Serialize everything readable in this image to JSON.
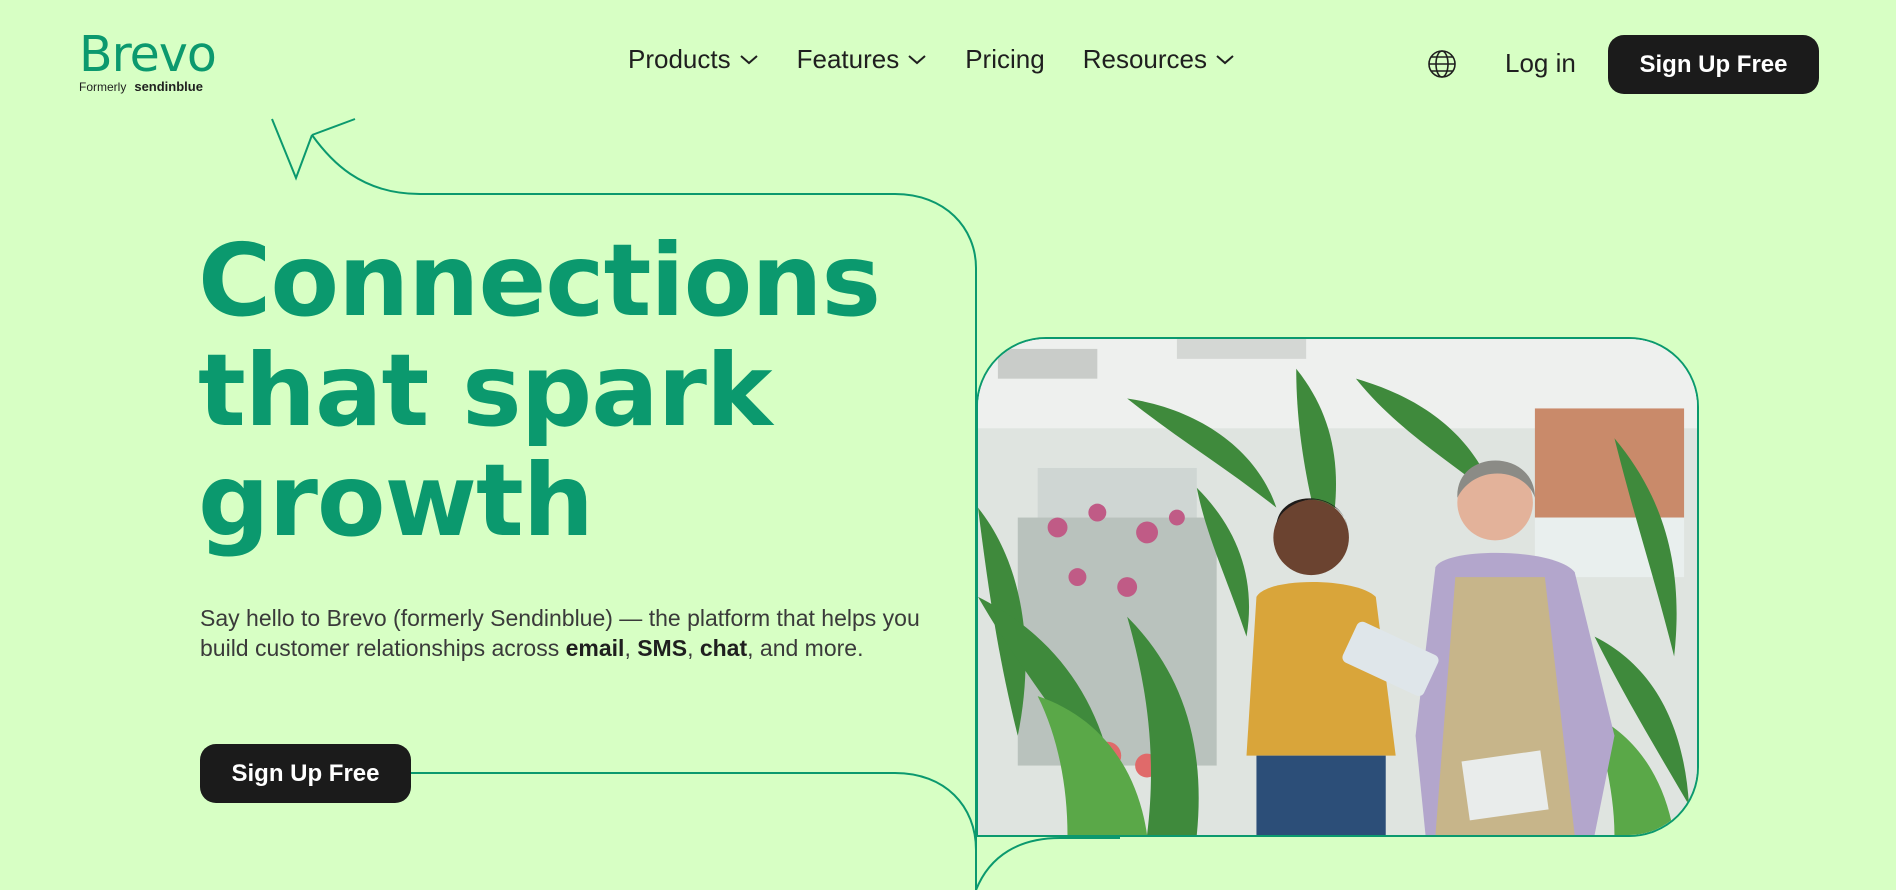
{
  "brand": {
    "name": "Brevo",
    "formerly_label": "Formerly",
    "formerly_name": "sendinblue"
  },
  "nav": {
    "items": [
      {
        "label": "Products",
        "has_dropdown": true
      },
      {
        "label": "Features",
        "has_dropdown": true
      },
      {
        "label": "Pricing",
        "has_dropdown": false
      },
      {
        "label": "Resources",
        "has_dropdown": true
      }
    ],
    "login_label": "Log in",
    "signup_label": "Sign Up Free",
    "language_icon": "globe-icon"
  },
  "hero": {
    "headline_line1": "Connections",
    "headline_line2": "that spark",
    "headline_line3": "growth",
    "subtext_intro": "Say hello to Brevo (formerly Sendinblue) — the platform that helps you build customer relationships across ",
    "subtext_email": "email",
    "subtext_sep1": ", ",
    "subtext_sms": "SMS",
    "subtext_sep2": ", ",
    "subtext_chat": "chat",
    "subtext_outro": ", and more.",
    "cta_label": "Sign Up Free",
    "image_icon": "photo-two-women-plant-shop"
  },
  "colors": {
    "background": "#d7ffc4",
    "accent": "#0b996e",
    "button": "#1b1b1b"
  }
}
